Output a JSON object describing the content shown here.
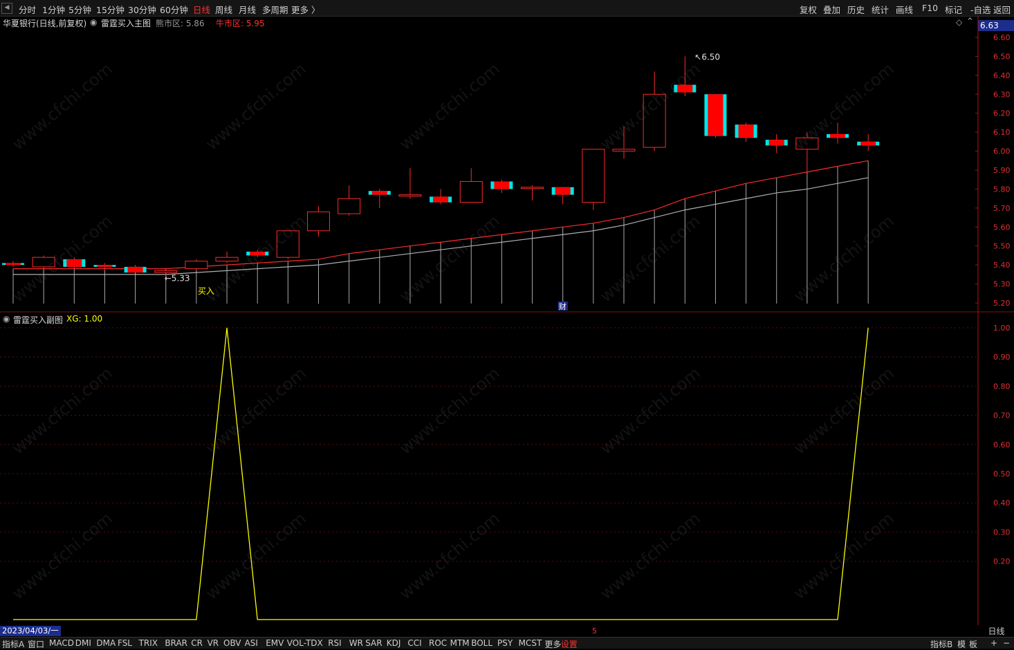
{
  "toolbar": {
    "left_items": [
      "分时",
      "1分钟",
      "5分钟",
      "15分钟",
      "30分钟",
      "60分钟",
      "日线",
      "周线",
      "月线",
      "多周期",
      "更多 〉"
    ],
    "active": "日线",
    "right_items": [
      "复权",
      "叠加",
      "历史",
      "统计",
      "画线",
      "F10",
      "标记",
      "-自选",
      "返回"
    ],
    "collapse_icon": "collapse-icon"
  },
  "main_header": {
    "stock": "华夏银行(日线,前复权)",
    "indicator": "雷霆买入主图",
    "bear_label": "熊市区: 5.86",
    "bull_label": "牛市区: 5.95"
  },
  "sub_header": {
    "indicator": "雷霆买入副图",
    "value_label": "XG: 1.00"
  },
  "price_badge": "6.63",
  "annotations": {
    "high_label": "6.50",
    "low_label": "5.33",
    "buy_label": "买入",
    "finance_label": "财"
  },
  "footer": {
    "date": "2023/04/03/一",
    "period": "日线",
    "marker": "5",
    "tabs": [
      "指标A",
      "窗口",
      "MACD",
      "DMI",
      "DMA",
      "FSL",
      "TRIX",
      "BRAR",
      "CR",
      "VR",
      "OBV",
      "ASI",
      "EMV",
      "VOL-TDX",
      "RSI",
      "WR",
      "SAR",
      "KDJ",
      "CCI",
      "ROC",
      "MTM",
      "BOLL",
      "PSY",
      "MCST",
      "更多",
      "设置"
    ],
    "active_tab": "设置",
    "right_tabs": [
      "指标B",
      "模",
      "板",
      "+",
      "−"
    ]
  },
  "watermark": "www.cfchi.com",
  "colors": {
    "up": "#ff2a2a",
    "down_body": "#ff0000",
    "down_edge": "#00e5e5",
    "ma_red": "#ff2a2a",
    "ma_gray": "#b0b0b0",
    "signal": "#ffff00",
    "axis": "#e03030",
    "badge_bg": "#1c2d8c"
  },
  "chart_data": [
    {
      "type": "candlestick",
      "title": "雷霆买入主图",
      "ylim": [
        5.2,
        6.63
      ],
      "y_ticks": [
        "6.60",
        "6.50",
        "6.40",
        "6.30",
        "6.20",
        "6.10",
        "6.00",
        "5.90",
        "5.80",
        "5.70",
        "5.60",
        "5.50",
        "5.40",
        "5.30",
        "5.20"
      ],
      "candles": [
        {
          "o": 5.41,
          "h": 5.42,
          "l": 5.39,
          "c": 5.4
        },
        {
          "o": 5.39,
          "h": 5.45,
          "l": 5.38,
          "c": 5.44
        },
        {
          "o": 5.43,
          "h": 5.44,
          "l": 5.38,
          "c": 5.39
        },
        {
          "o": 5.4,
          "h": 5.41,
          "l": 5.37,
          "c": 5.39
        },
        {
          "o": 5.39,
          "h": 5.4,
          "l": 5.36,
          "c": 5.36
        },
        {
          "o": 5.36,
          "h": 5.38,
          "l": 5.33,
          "c": 5.37
        },
        {
          "o": 5.38,
          "h": 5.43,
          "l": 5.37,
          "c": 5.42
        },
        {
          "o": 5.42,
          "h": 5.47,
          "l": 5.41,
          "c": 5.44
        },
        {
          "o": 5.47,
          "h": 5.48,
          "l": 5.44,
          "c": 5.45
        },
        {
          "o": 5.44,
          "h": 5.58,
          "l": 5.43,
          "c": 5.58
        },
        {
          "o": 5.58,
          "h": 5.71,
          "l": 5.55,
          "c": 5.68
        },
        {
          "o": 5.67,
          "h": 5.82,
          "l": 5.66,
          "c": 5.75
        },
        {
          "o": 5.79,
          "h": 5.8,
          "l": 5.7,
          "c": 5.77
        },
        {
          "o": 5.77,
          "h": 5.91,
          "l": 5.75,
          "c": 5.77
        },
        {
          "o": 5.76,
          "h": 5.8,
          "l": 5.72,
          "c": 5.73
        },
        {
          "o": 5.73,
          "h": 5.91,
          "l": 5.73,
          "c": 5.84
        },
        {
          "o": 5.84,
          "h": 5.85,
          "l": 5.78,
          "c": 5.8
        },
        {
          "o": 5.81,
          "h": 5.82,
          "l": 5.74,
          "c": 5.81
        },
        {
          "o": 5.81,
          "h": 5.81,
          "l": 5.72,
          "c": 5.77
        },
        {
          "o": 5.73,
          "h": 6.01,
          "l": 5.69,
          "c": 6.01
        },
        {
          "o": 6.0,
          "h": 6.13,
          "l": 5.96,
          "c": 6.01
        },
        {
          "o": 6.02,
          "h": 6.42,
          "l": 6.0,
          "c": 6.3
        },
        {
          "o": 6.35,
          "h": 6.5,
          "l": 6.29,
          "c": 6.31
        },
        {
          "o": 6.3,
          "h": 6.3,
          "l": 6.07,
          "c": 6.08
        },
        {
          "o": 6.14,
          "h": 6.15,
          "l": 6.05,
          "c": 6.07
        },
        {
          "o": 6.06,
          "h": 6.09,
          "l": 5.99,
          "c": 6.03
        },
        {
          "o": 6.01,
          "h": 6.1,
          "l": 5.89,
          "c": 6.07
        },
        {
          "o": 6.09,
          "h": 6.15,
          "l": 6.04,
          "c": 6.07
        },
        {
          "o": 6.05,
          "h": 6.09,
          "l": 6.0,
          "c": 6.03
        }
      ],
      "ma_red": [
        5.38,
        5.38,
        5.38,
        5.38,
        5.38,
        5.38,
        5.39,
        5.4,
        5.41,
        5.42,
        5.43,
        5.46,
        5.48,
        5.5,
        5.52,
        5.54,
        5.56,
        5.58,
        5.6,
        5.62,
        5.65,
        5.69,
        5.75,
        5.79,
        5.83,
        5.86,
        5.89,
        5.92,
        5.95
      ],
      "ma_gray": [
        5.35,
        5.35,
        5.35,
        5.35,
        5.35,
        5.35,
        5.36,
        5.37,
        5.38,
        5.39,
        5.4,
        5.42,
        5.44,
        5.46,
        5.48,
        5.5,
        5.52,
        5.54,
        5.56,
        5.58,
        5.61,
        5.65,
        5.69,
        5.72,
        5.75,
        5.78,
        5.8,
        5.83,
        5.86
      ]
    },
    {
      "type": "line",
      "title": "雷霆买入副图",
      "ylim": [
        0,
        1.0
      ],
      "y_ticks": [
        "1.00",
        "0.90",
        "0.80",
        "0.70",
        "0.60",
        "0.50",
        "0.40",
        "0.30",
        "0.20"
      ],
      "series": [
        {
          "name": "XG",
          "values": [
            0,
            0,
            0,
            0,
            0,
            0,
            0,
            1,
            0,
            0,
            0,
            0,
            0,
            0,
            0,
            0,
            0,
            0,
            0,
            0,
            0,
            0,
            0,
            0,
            0,
            0,
            0,
            0,
            1
          ]
        }
      ]
    }
  ]
}
